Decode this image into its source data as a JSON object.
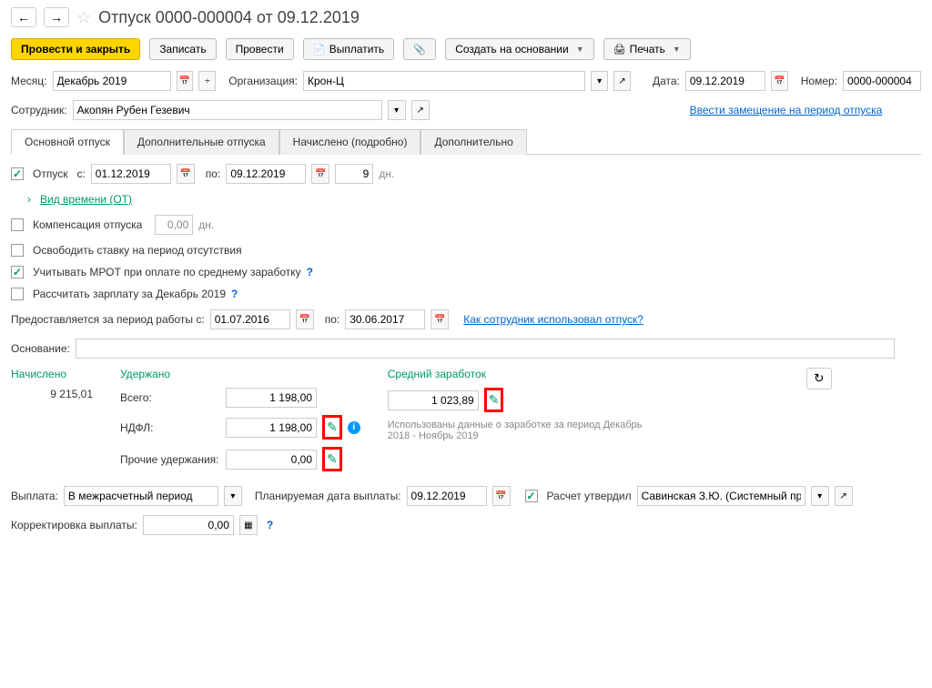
{
  "header": {
    "title": "Отпуск 0000-000004 от 09.12.2019"
  },
  "toolbar": {
    "post_close": "Провести и закрыть",
    "save": "Записать",
    "post": "Провести",
    "pay": "Выплатить",
    "create_based": "Создать на основании",
    "print": "Печать"
  },
  "fields": {
    "month_label": "Месяц:",
    "month_value": "Декабрь 2019",
    "org_label": "Организация:",
    "org_value": "Крон-Ц",
    "date_label": "Дата:",
    "date_value": "09.12.2019",
    "number_label": "Номер:",
    "number_value": "0000-000004",
    "employee_label": "Сотрудник:",
    "employee_value": "Акопян Рубен Гезевич",
    "substitution_link": "Ввести замещение на период отпуска"
  },
  "tabs": [
    {
      "label": "Основной отпуск"
    },
    {
      "label": "Дополнительные отпуска"
    },
    {
      "label": "Начислено (подробно)"
    },
    {
      "label": "Дополнительно"
    }
  ],
  "main": {
    "vacation_label": "Отпуск",
    "from_label": "с:",
    "from_value": "01.12.2019",
    "to_label": "по:",
    "to_value": "09.12.2019",
    "days_value": "9",
    "days_unit": "дн.",
    "time_type_link": "Вид времени (ОТ)",
    "compensation_label": "Компенсация отпуска",
    "compensation_value": "0,00",
    "compensation_unit": "дн.",
    "free_rate_label": "Освободить ставку на период отсутствия",
    "mrot_label": "Учитывать МРОТ при оплате по среднему заработку",
    "calc_salary_label": "Рассчитать зарплату за Декабрь 2019",
    "period_label": "Предоставляется за период работы с:",
    "period_from": "01.07.2016",
    "period_to_label": "по:",
    "period_to": "30.06.2017",
    "usage_link": "Как сотрудник использовал отпуск?",
    "reason_label": "Основание:"
  },
  "calc": {
    "accrued_label": "Начислено",
    "accrued_value": "9 215,01",
    "withheld_label": "Удержано",
    "total_label": "Всего:",
    "total_value": "1 198,00",
    "ndfl_label": "НДФЛ:",
    "ndfl_value": "1 198,00",
    "other_label": "Прочие удержания:",
    "other_value": "0,00",
    "avg_label": "Средний заработок",
    "avg_value": "1 023,89",
    "info_text": "Использованы данные о заработке за период Декабрь 2018 - Ноябрь 2019"
  },
  "payment": {
    "payment_label": "Выплата:",
    "payment_value": "В межрасчетный период",
    "planned_label": "Планируемая дата выплаты:",
    "planned_value": "09.12.2019",
    "approved_label": "Расчет утвердил",
    "approver_value": "Савинская З.Ю. (Системный прог",
    "correction_label": "Корректировка выплаты:",
    "correction_value": "0,00"
  }
}
